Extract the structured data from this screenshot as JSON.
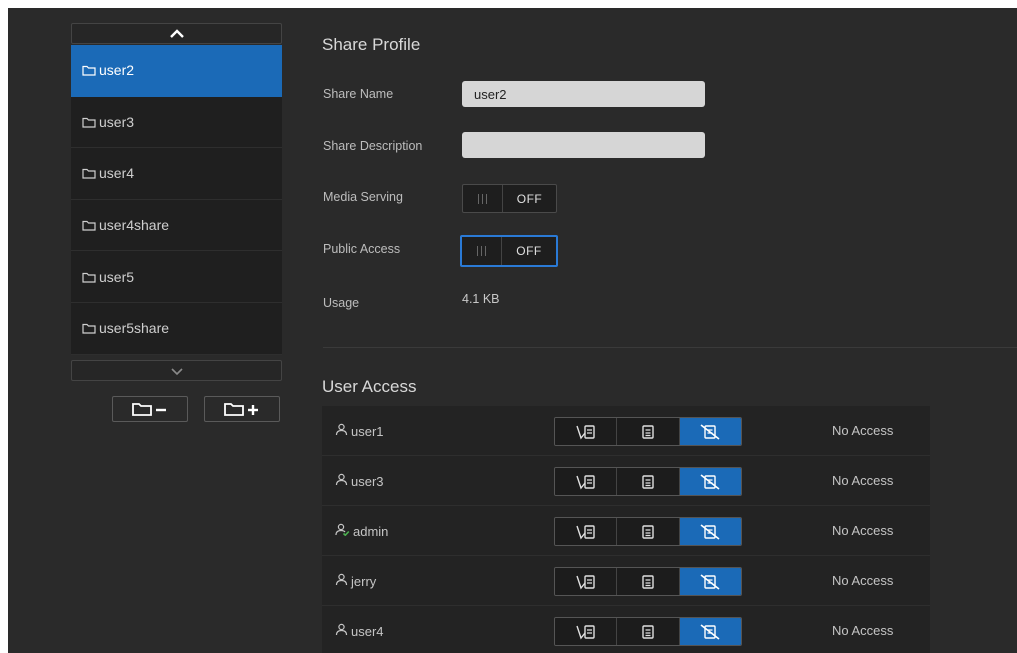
{
  "shares": {
    "items": [
      {
        "label": "user2",
        "selected": true
      },
      {
        "label": "user3",
        "selected": false
      },
      {
        "label": "user4",
        "selected": false
      },
      {
        "label": "user4share",
        "selected": false
      },
      {
        "label": "user5",
        "selected": false
      },
      {
        "label": "user5share",
        "selected": false
      }
    ],
    "scroll_up_icon": "chevron-up-icon",
    "scroll_down_icon": "chevron-down-icon",
    "remove_icon": "folder-minus-icon",
    "add_icon": "folder-plus-icon"
  },
  "profile": {
    "title": "Share Profile",
    "share_name_label": "Share Name",
    "share_name_value": "user2",
    "share_description_label": "Share Description",
    "share_description_value": "",
    "media_serving_label": "Media Serving",
    "media_serving_state": "OFF",
    "public_access_label": "Public Access",
    "public_access_state": "OFF",
    "usage_label": "Usage",
    "usage_value": "4.1 KB"
  },
  "user_access": {
    "title": "User Access",
    "permission_icons": [
      "read-write-icon",
      "read-only-icon",
      "no-access-icon"
    ],
    "users": [
      {
        "name": "user1",
        "icon": "user-icon",
        "access": "No Access",
        "active_permission": 2
      },
      {
        "name": "user3",
        "icon": "user-icon",
        "access": "No Access",
        "active_permission": 2
      },
      {
        "name": "admin",
        "icon": "admin-user-icon",
        "access": "No Access",
        "active_permission": 2
      },
      {
        "name": "jerry",
        "icon": "user-icon",
        "access": "No Access",
        "active_permission": 2
      },
      {
        "name": "user4",
        "icon": "user-icon",
        "access": "No Access",
        "active_permission": 2
      }
    ]
  },
  "colors": {
    "accent": "#1b6ab7",
    "background": "#2a2a2a",
    "admin_badge": "#4caf50"
  }
}
